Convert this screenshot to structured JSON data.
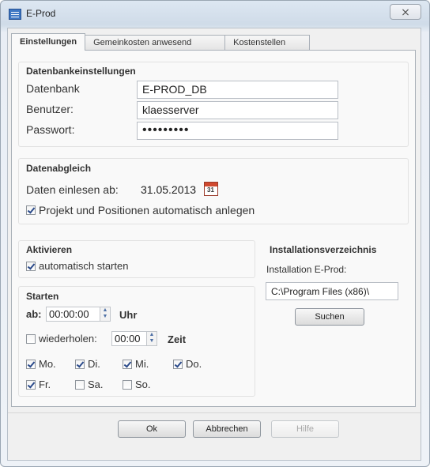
{
  "window": {
    "title": "E-Prod",
    "close_label": "⨯"
  },
  "tabs": [
    {
      "label": "Einstellungen"
    },
    {
      "label": "Gemeinkosten anwesend"
    },
    {
      "label": "Kostenstellen"
    }
  ],
  "db": {
    "title": "Datenbankeinstellungen",
    "datenbank_label": "Datenbank",
    "datenbank_value": "E-PROD_DB",
    "benutzer_label": "Benutzer:",
    "benutzer_value": "klaesserver",
    "passwort_label": "Passwort:",
    "passwort_value": "•••••••••"
  },
  "sync": {
    "title": "Datenabgleich",
    "daten_label": "Daten einlesen ab:",
    "daten_value": "31.05.2013",
    "calendar_text": "31",
    "auto_create_label": "Projekt und Positionen automatisch anlegen",
    "auto_create_checked": true
  },
  "aktivieren": {
    "title": "Aktivieren",
    "auto_start_label": "automatisch starten",
    "auto_start_checked": true
  },
  "starten": {
    "title": "Starten",
    "ab_label": "ab:",
    "ab_value": "00:00:00",
    "uhr_label": "Uhr",
    "wiederholen_label": "wiederholen:",
    "wiederholen_checked": false,
    "wiederholen_value": "00:00",
    "zeit_label": "Zeit",
    "days": [
      {
        "label": "Mo.",
        "checked": true
      },
      {
        "label": "Di.",
        "checked": true
      },
      {
        "label": "Mi.",
        "checked": true
      },
      {
        "label": "Do.",
        "checked": true
      },
      {
        "label": "Fr.",
        "checked": true
      },
      {
        "label": "Sa.",
        "checked": false
      },
      {
        "label": "So.",
        "checked": false
      }
    ]
  },
  "install": {
    "title": "Installationsverzeichnis",
    "label": "Installation E-Prod:",
    "path": "C:\\Program Files (x86)\\",
    "search_label": "Suchen"
  },
  "footer": {
    "ok_label": "Ok",
    "cancel_label": "Abbrechen",
    "help_label": "Hilfe"
  }
}
